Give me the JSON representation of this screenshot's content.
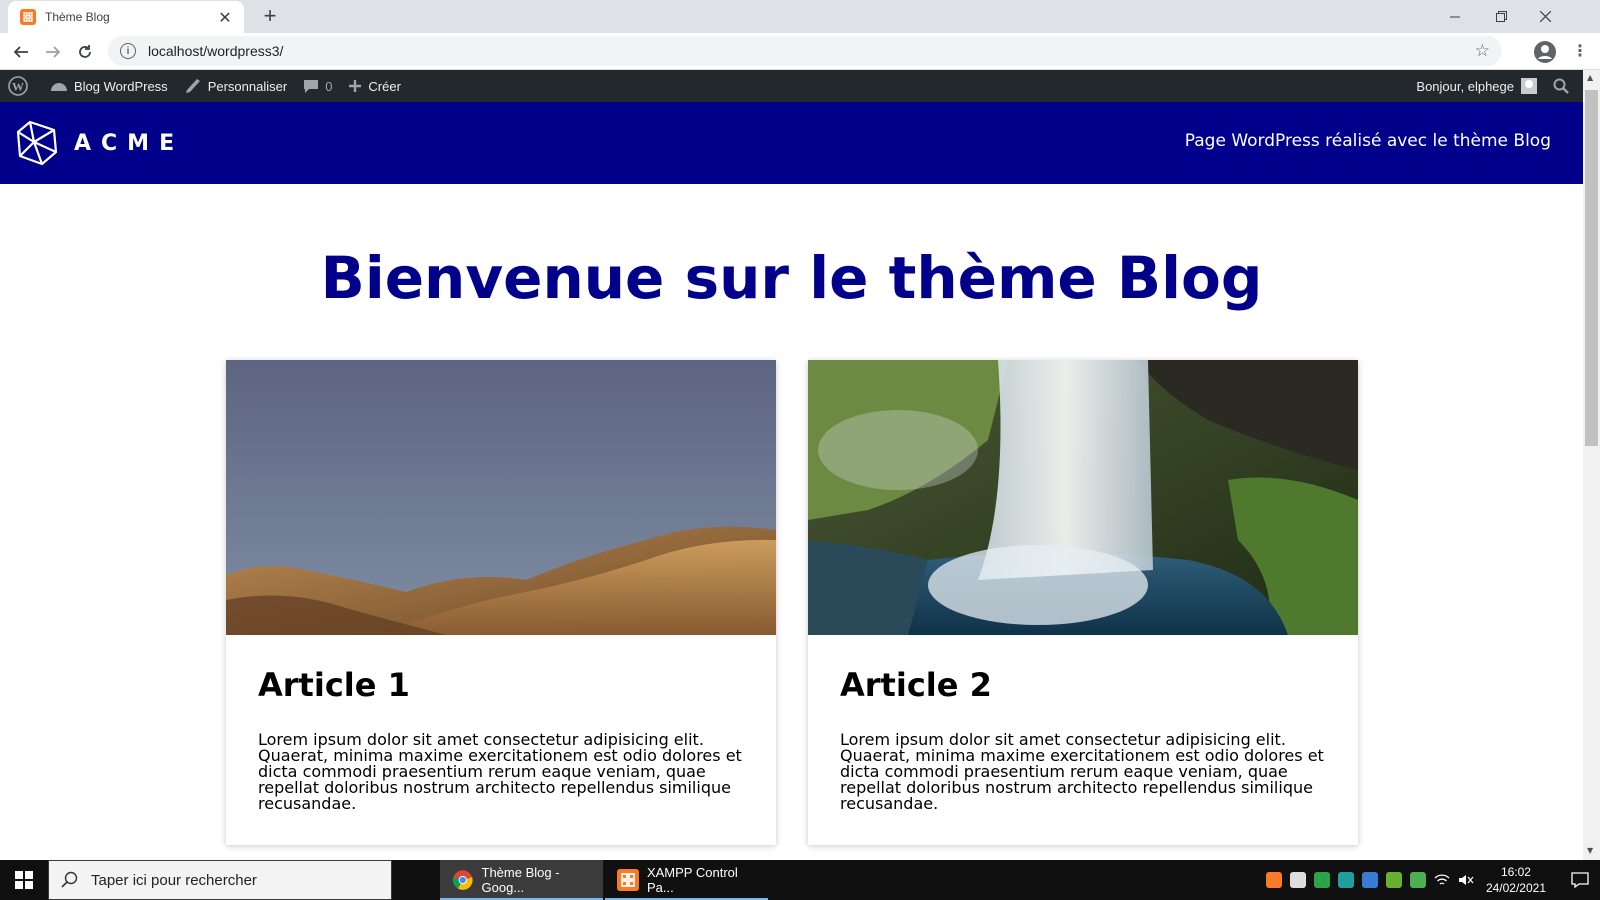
{
  "browser": {
    "tab_title": "Thème Blog",
    "tab_close": "✕",
    "new_tab": "+",
    "url": "localhost/wordpress3/",
    "info_icon": "i",
    "star_icon": "☆",
    "menu_icon": "⋮"
  },
  "adminbar": {
    "site_name": "Blog WordPress",
    "customize": "Personnaliser",
    "comments_count": "0",
    "new": "Créer",
    "greeting": "Bonjour, elphege"
  },
  "site": {
    "logo_text": "ACME",
    "tagline": "Page WordPress réalisé avec le thème Blog",
    "header_color": "#00008b"
  },
  "main": {
    "title": "Bienvenue sur le thème Blog",
    "articles": [
      {
        "title": "Article 1",
        "text": "Lorem ipsum dolor sit amet consectetur adipisicing elit. Quaerat, minima maxime exercitationem est odio dolores et dicta commodi praesentium rerum eaque veniam, quae repellat doloribus nostrum architecto repellendus similique recusandae.",
        "image": "desert-hills"
      },
      {
        "title": "Article 2",
        "text": "Lorem ipsum dolor sit amet consectetur adipisicing elit. Quaerat, minima maxime exercitationem est odio dolores et dicta commodi praesentium rerum eaque veniam, quae repellat doloribus nostrum architecto repellendus similique recusandae.",
        "image": "waterfall"
      }
    ]
  },
  "taskbar": {
    "search_placeholder": "Taper ici pour rechercher",
    "apps": [
      {
        "label": "Thème Blog - Goog..."
      },
      {
        "label": "XAMPP Control Pa..."
      }
    ],
    "time": "16:02",
    "date": "24/02/2021"
  }
}
